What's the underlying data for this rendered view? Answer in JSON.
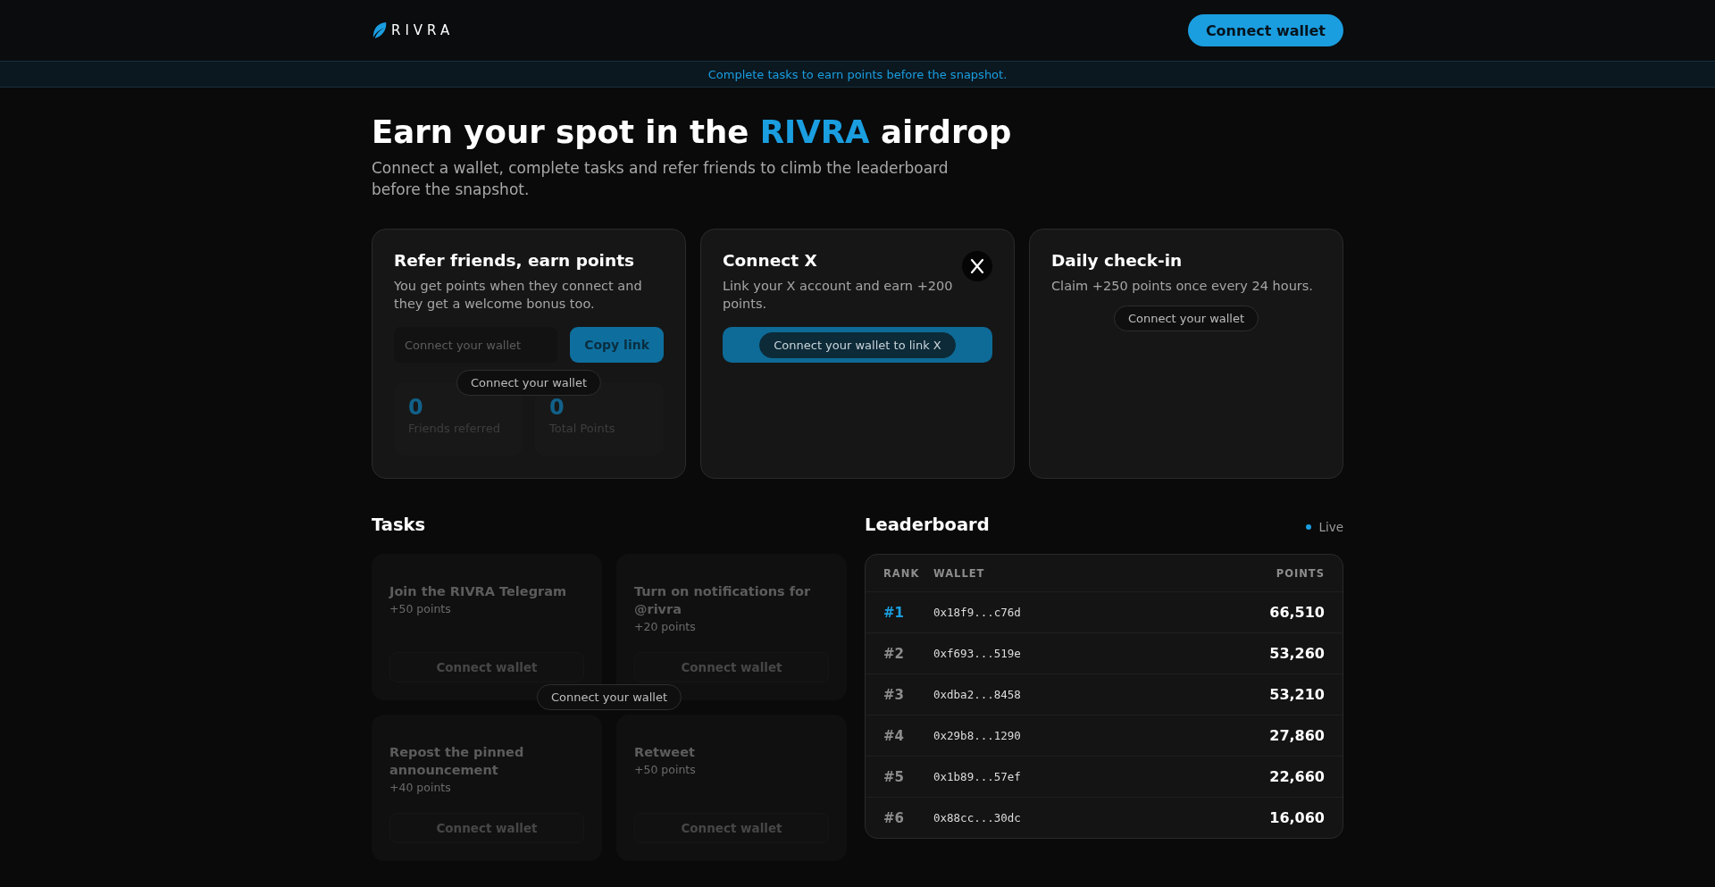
{
  "header": {
    "logo": "RIVRA",
    "connect_button": "Connect wallet"
  },
  "banner": "Complete tasks to earn points before the snapshot.",
  "hero": {
    "title": "Earn your spot in the **RIVRA** airdrop",
    "subtitle": "Connect a wallet, complete tasks and refer friends to climb the leaderboard before the snapshot."
  },
  "referral_card": {
    "title": "Refer friends, earn points",
    "description": "You get points when they connect and they get a welcome bonus too.",
    "link_field": {
      "placeholder": "Connect your wallet"
    },
    "copy_button": "Copy link",
    "notice": "Connect your wallet",
    "stats": [
      {
        "value": "0",
        "label": "Friends referred"
      },
      {
        "value": "0",
        "label": "Total Points"
      }
    ]
  },
  "x_card": {
    "title": "Connect X",
    "description": "Link your X account and earn +200 points.",
    "notice": "Connect your wallet to link X"
  },
  "checkin_card": {
    "title": "Daily check-in",
    "description": "Claim +250 points once every 24 hours.",
    "notice": "Connect your wallet"
  },
  "tasks": {
    "heading": "Tasks",
    "notice": "Connect your wallet",
    "items": [
      {
        "title": "Join the RIVRA Telegram",
        "points": "+50 points",
        "button": "Connect wallet"
      },
      {
        "title": "Turn on notifications for @rivra",
        "points": "+20 points",
        "button": "Connect wallet"
      },
      {
        "title": "Repost the pinned announcement",
        "points": "+40 points",
        "button": "Connect wallet"
      },
      {
        "title": "Retweet",
        "points": "+50 points",
        "button": "Connect wallet"
      }
    ]
  },
  "leaderboard": {
    "heading": "Leaderboard",
    "status": {
      "label": "Live",
      "color": "#1a9ee0"
    },
    "columns": [
      "RANK",
      "WALLET",
      "POINTS"
    ],
    "rows": [
      {
        "rank": "#1",
        "wallet": "0x18f9...c76d",
        "points": "66,510",
        "highlighted": true
      },
      {
        "rank": "#2",
        "wallet": "0xf693...519e",
        "points": "53,260",
        "highlighted": false
      },
      {
        "rank": "#3",
        "wallet": "0xdba2...8458",
        "points": "53,210",
        "highlighted": false
      },
      {
        "rank": "#4",
        "wallet": "0x29b8...1290",
        "points": "27,860",
        "highlighted": false
      },
      {
        "rank": "#5",
        "wallet": "0x1b89...57ef",
        "points": "22,660",
        "highlighted": false
      },
      {
        "rank": "#6",
        "wallet": "0x88cc...30dc",
        "points": "16,060",
        "highlighted": false
      }
    ]
  }
}
